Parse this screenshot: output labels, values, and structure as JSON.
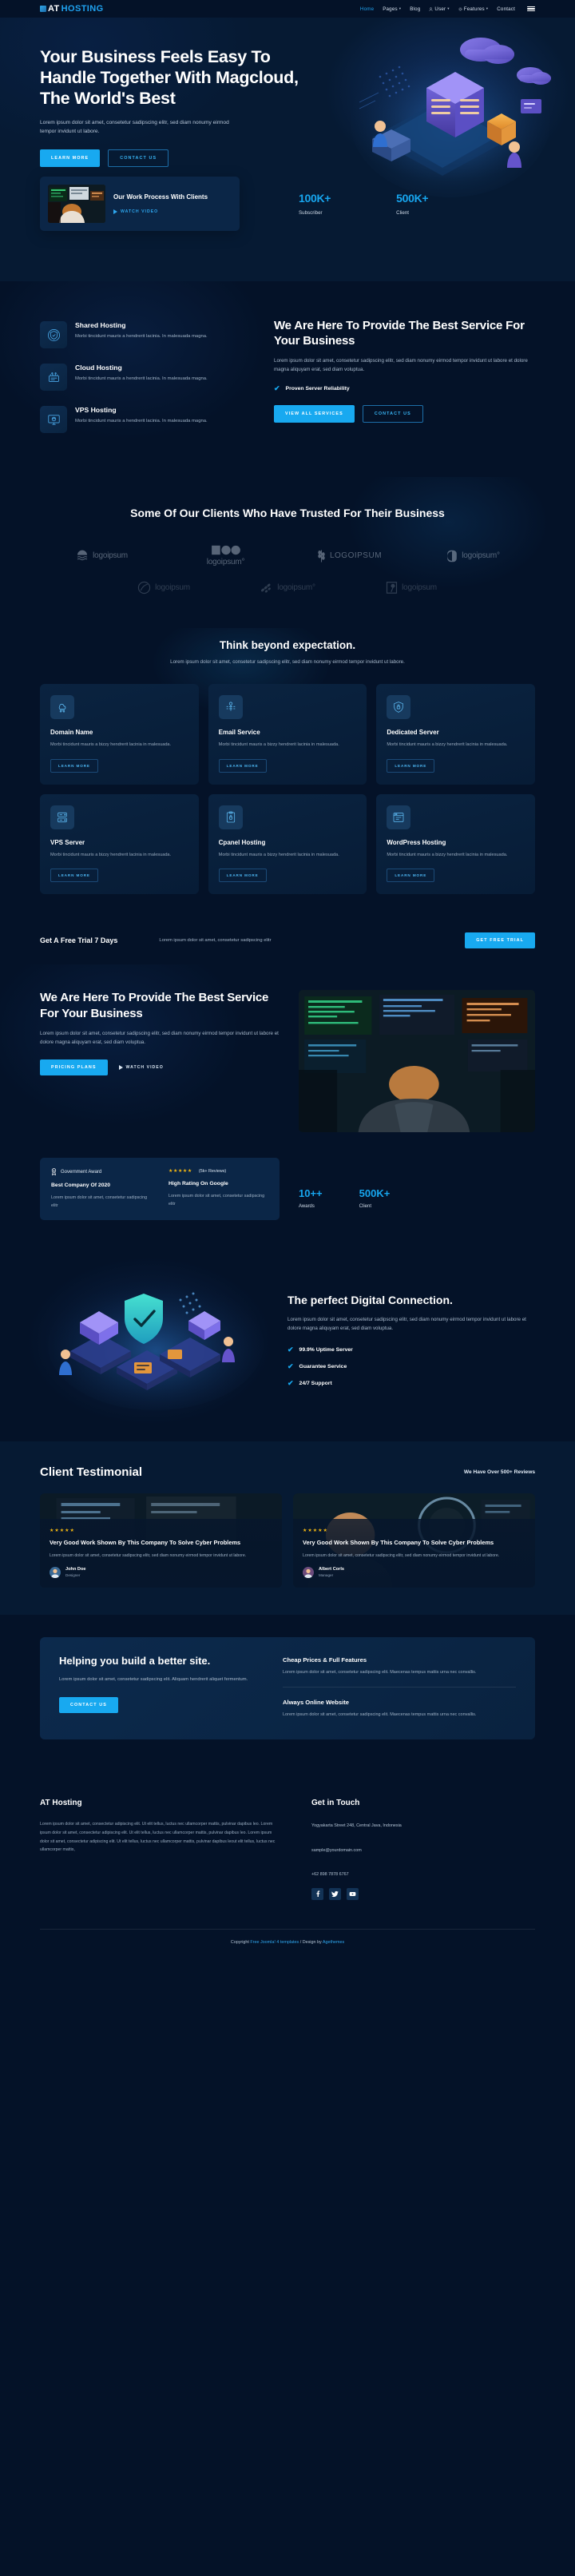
{
  "header": {
    "logo_text_1": "AT",
    "logo_text_2": "HOSTING",
    "nav": [
      {
        "label": "Home",
        "active": true,
        "caret": false,
        "icon": ""
      },
      {
        "label": "Pages",
        "active": false,
        "caret": true,
        "icon": ""
      },
      {
        "label": "Blog",
        "active": false,
        "caret": false,
        "icon": ""
      },
      {
        "label": "User",
        "active": false,
        "caret": true,
        "icon": "user-icon"
      },
      {
        "label": "Features",
        "active": false,
        "caret": true,
        "icon": "gear-icon"
      },
      {
        "label": "Contact",
        "active": false,
        "caret": false,
        "icon": ""
      }
    ],
    "menu_toggle": "hamburger-icon"
  },
  "hero": {
    "title": "Your Business Feels Easy To Handle Together With Magcloud, The World's Best",
    "subtitle": "Lorem ipsum dolor sit amet, consetetur sadipscing elitr, sed diam nonumy eirmod tempor invidunt ut labore.",
    "primary_button": "LEARN MORE",
    "secondary_button": "CONTACT US"
  },
  "process": {
    "title": "Our Work Process With Clients",
    "watch_label": "WATCH VIDEO"
  },
  "hero_stats": [
    {
      "number": "100K+",
      "label": "Subscriber"
    },
    {
      "number": "500K+",
      "label": "Client"
    }
  ],
  "services": {
    "items": [
      {
        "title": "Shared Hosting",
        "desc": "Morbi tincidunt mauris a hendrerit lacinia. In malesuada magna.",
        "icon": "shield-globe-icon"
      },
      {
        "title": "Cloud Hosting",
        "desc": "Morbi tincidunt mauris a hendrerit lacinia. In malesuada magna.",
        "icon": "server-cloud-icon"
      },
      {
        "title": "VPS Hosting",
        "desc": "Morbi tincidunt mauris a hendrerit lacinia. In malesuada magna.",
        "icon": "monitor-icon"
      }
    ],
    "heading": "We Are Here To Provide The Best Service For Your Business",
    "paragraph": "Lorem ipsum dolor sit amet, consetetur sadipscing elitr, sed diam nonumy eirmod tempor invidunt ut labore et dolore magna aliquyam erat, sed diam voluptua.",
    "check": "Proven Server Reliability",
    "btn_primary": "VIEW ALL SERVICES",
    "btn_outline": "CONTACT US"
  },
  "clients": {
    "title": "Some Of Our Clients Who Have Trusted For Their Business",
    "logos": [
      {
        "name": "logoipsum",
        "mark": "waves"
      },
      {
        "name": "logoipsum°",
        "mark": "shapes"
      },
      {
        "name": "LOGOIPSUM",
        "mark": "wheat"
      },
      {
        "name": "logoipsum°",
        "mark": "halfmoon"
      },
      {
        "name": "logoipsum",
        "mark": "circleslash"
      },
      {
        "name": "logoipsum°",
        "mark": "dots"
      },
      {
        "name": "logoipsum",
        "mark": "pin"
      }
    ]
  },
  "features": {
    "title": "Think beyond expectation.",
    "subtitle": "Lorem ipsum dolor sit amet, consetetur sadipscing elitr, sed diam nonumy eirmod tempor invidunt ut labore.",
    "cards": [
      {
        "title": "Domain Name",
        "desc": "Morbi tincidunt mauris a bizzy hendrerit lacinia in malesuada.",
        "button": "LEARN MORE",
        "icon": "cloud-network-icon"
      },
      {
        "title": "Email Service",
        "desc": "Morbi tincidunt mauris a bizzy hendrerit lacinia in malesuada.",
        "button": "LEARN MORE",
        "icon": "key-circuit-icon"
      },
      {
        "title": "Dedicated Server",
        "desc": "Morbi tincidunt mauris a bizzy hendrerit lacinia in malesuada.",
        "button": "LEARN MORE",
        "icon": "shield-lock-icon"
      },
      {
        "title": "VPS Server",
        "desc": "Morbi tincidunt mauris a bizzy hendrerit lacinia in malesuada.",
        "button": "LEARN MORE",
        "icon": "server-rack-icon"
      },
      {
        "title": "Cpanel Hosting",
        "desc": "Morbi tincidunt mauris a bizzy hendrerit lacinia in malesuada.",
        "button": "LEARN MORE",
        "icon": "clipboard-lock-icon"
      },
      {
        "title": "WordPress Hosting",
        "desc": "Morbi tincidunt mauris a bizzy hendrerit lacinia in malesuada.",
        "button": "LEARN MORE",
        "icon": "browser-icon"
      }
    ]
  },
  "trial": {
    "title": "Get A Free Trial 7 Days",
    "text": "Lorem ipsum dolor sit amet, consetetur sadipscing elitr",
    "button": "GET FREE TRIAL"
  },
  "about": {
    "title": "We Are Here To Provide The Best Service For Your Business",
    "paragraph": "Lorem ipsum dolor sit amet, consetetur sadipscing elitr, sed diam nonumy eirmod tempor invidunt ut labore et dolore magna aliquyam erat, sed diam voluptua.",
    "btn_primary": "PRICING PLANS",
    "watch_label": "WATCH VIDEO"
  },
  "awards": {
    "left": {
      "badge": "Government Award",
      "title": "Best Company Of 2020",
      "desc": "Lorem ipsum dolor sit amet, consetetur sadipscing elitr"
    },
    "right": {
      "stars": "★★★★★",
      "reviews": "(5k+ Reviews)",
      "title": "High Rating On Google",
      "desc": "Lorem ipsum dolor sit amet, consetetur sadipscing elitr"
    },
    "stats": [
      {
        "number": "10++",
        "label": "Awards"
      },
      {
        "number": "500K+",
        "label": "Client"
      }
    ]
  },
  "digital": {
    "title": "The perfect Digital Connection.",
    "paragraph": "Lorem ipsum dolor sit amet, consetetur sadipscing elitr, sed diam nonumy eirmod tempor invidunt ut labore et dolore magna aliquyam erat, sed diam voluptua.",
    "checks": [
      "99.9% Uptime Server",
      "Guarantee Service",
      "24/7 Support"
    ]
  },
  "testimonial": {
    "title": "Client Testimonial",
    "note": "We Have Over 500+ Reviews",
    "cards": [
      {
        "stars": "★★★★★",
        "title": "Very Good Work Shown By This Company To Solve Cyber Problems",
        "text": "Lorem ipsum dolor sit amet, consetetur sadipscing elitr, sed diam nonumy eirmod tempor invidunt ut labore.",
        "name": "John Doe",
        "role": "Designer"
      },
      {
        "stars": "★★★★★",
        "title": "Very Good Work Shown By This Company To Solve Cyber Problems",
        "text": "Lorem ipsum dolor sit amet, consetetur sadipscing elitr, sed diam nonumy eirmod tempor invidunt ut labore.",
        "name": "Albert Corls",
        "role": "Manager"
      }
    ]
  },
  "helping": {
    "title": "Helping you build a better site.",
    "paragraph": "Lorem ipsum dolor sit amet, consetetur sadipscing elit. Aliquam hendrerit aliquet fermentum.",
    "button": "CONTACT US",
    "items": [
      {
        "title": "Cheap Prices & Full Features",
        "desc": "Lorem ipsum dolor sit amet, consetetur sadipscing elit. Maecenas tempus mattis urna nec convallis."
      },
      {
        "title": "Always Online Website",
        "desc": "Lorem ipsum dolor sit amet, consetetur sadipscing elit. Maecenas tempus mattis urna nec convallis."
      }
    ]
  },
  "footer": {
    "brand_title": "AT Hosting",
    "brand_text": "Lorem ipsum dolor sit amet, consectetur adipiscing elit. Ut elit tellus, luctus nec ullamcorper mattis, pulvinar dapibus leo. Lorem ipsum dolor sit amet, consectetur adipiscing elit. Ut elit tellus, luctus nec ullamcorper mattis, pulvinar dapibus leo. Lorem ipsum dolor sit amet, consectetur adipiscing elit. Ut elit tellus, luctus nec ullamcorper mattis, pulvinar dapibus leout elit tellus, luctus nec ullamcorper mattis,",
    "contact_title": "Get in Touch",
    "address": "Yogyakarta Street 248, Central Java, Indonesia",
    "email": "sample@yourdomain.com",
    "phone": "+62 898 7878 6767",
    "socials": [
      "facebook-icon",
      "twitter-icon",
      "youtube-icon"
    ],
    "copyright_prefix": "Copyright ",
    "copyright_link1": "Free Joomla! 4 templates",
    "copyright_mid": " / Design by ",
    "copyright_link2": "Agethemes"
  },
  "colors": {
    "accent": "#18a9f0",
    "bg": "#041228",
    "panel": "#0b2647",
    "star": "#f3b712"
  }
}
